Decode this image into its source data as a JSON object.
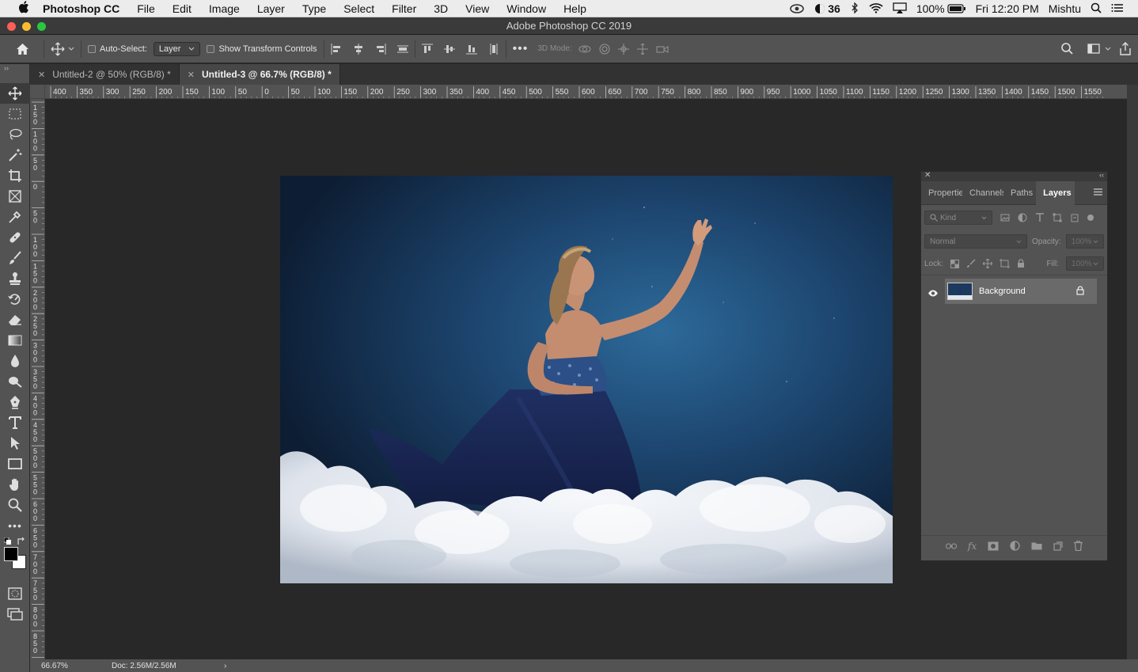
{
  "menubar": {
    "apple_icon": "apple-icon",
    "app_name": "Photoshop CC",
    "items": [
      "File",
      "Edit",
      "Image",
      "Layer",
      "Type",
      "Select",
      "Filter",
      "3D",
      "View",
      "Window",
      "Help"
    ],
    "status_number": "36",
    "battery": "100%",
    "clock": "Fri 12:20 PM",
    "user": "Mishtu"
  },
  "window": {
    "title": "Adobe Photoshop CC 2019"
  },
  "options": {
    "auto_select_label": "Auto-Select:",
    "auto_select_value": "Layer",
    "transform_label": "Show Transform Controls",
    "mode_3d_label": "3D Mode:"
  },
  "tabs": [
    {
      "label": "Untitled-2 @ 50% (RGB/8) *",
      "active": false
    },
    {
      "label": "Untitled-3 @ 66.7% (RGB/8) *",
      "active": true
    }
  ],
  "ruler": {
    "h_labels": [
      "400",
      "350",
      "300",
      "250",
      "200",
      "150",
      "100",
      "50",
      "0",
      "50",
      "100",
      "150",
      "200",
      "250",
      "300",
      "350",
      "400",
      "450",
      "500",
      "550",
      "600",
      "650",
      "700",
      "750",
      "800",
      "850",
      "900",
      "950",
      "1000",
      "1050",
      "1100",
      "1150",
      "1200",
      "1250",
      "1300",
      "1350",
      "1400",
      "1450",
      "1500",
      "1550"
    ],
    "v_labels": [
      "150",
      "100",
      "50",
      "0",
      "50",
      "100",
      "150",
      "200",
      "250",
      "300",
      "350",
      "400",
      "450",
      "500",
      "550",
      "600",
      "650",
      "700",
      "750",
      "800",
      "850",
      "9"
    ]
  },
  "status": {
    "zoom": "66.67%",
    "doc": "Doc: 2.56M/2.56M"
  },
  "layers_panel": {
    "tabs": [
      "Properties",
      "Channels",
      "Paths",
      "Layers"
    ],
    "active_tab": "Layers",
    "filter_placeholder": "Kind",
    "blend_mode": "Normal",
    "opacity_label": "Opacity:",
    "opacity_value": "100%",
    "lock_label": "Lock:",
    "fill_label": "Fill:",
    "fill_value": "100%",
    "layers": [
      {
        "name": "Background",
        "visible": true,
        "locked": true
      }
    ]
  },
  "colors": {
    "ui_dark": "#282828",
    "ui_panel": "#535353",
    "accent_bg": "#1c3a5e"
  }
}
